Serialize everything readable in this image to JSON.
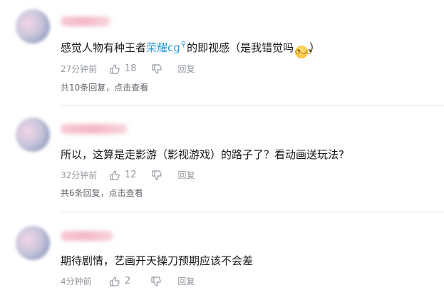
{
  "comments": [
    {
      "content_before": "感觉人物有种王者",
      "content_link": "荣耀cg",
      "content_after": "的即视感（是我错觉吗",
      "content_end": "）",
      "emoji_icon": "embarrassed-face-icon",
      "time": "27分钟前",
      "likes": "18",
      "reply_label": "回复",
      "more_replies": "共10条回复，点击查看"
    },
    {
      "content": "所以，这算是走影游（影视游戏）的路子了？看动画送玩法?",
      "time": "32分钟前",
      "likes": "12",
      "reply_label": "回复",
      "more_replies": "共6条回复，点击查看"
    },
    {
      "content": "期待剧情，艺画开天操刀预期应该不会差",
      "time": "4分钟前",
      "likes": "2",
      "reply_label": "回复"
    }
  ],
  "colors": {
    "link": "#2a9bd8",
    "meta": "#9499a0",
    "divider": "#e3e5e7"
  }
}
